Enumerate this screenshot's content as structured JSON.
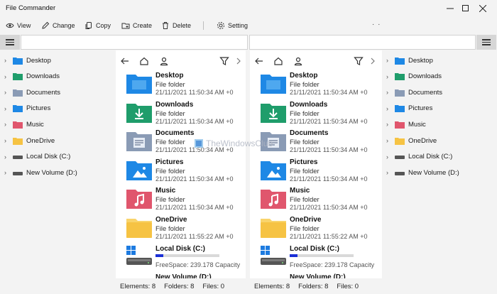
{
  "window": {
    "title": "File Commander"
  },
  "toolbar": {
    "view": "View",
    "change": "Change",
    "copy": "Copy",
    "create": "Create",
    "delete": "Delete",
    "setting": "Setting",
    "more": "· ·"
  },
  "tree": {
    "items": [
      {
        "label": "Desktop",
        "icon": "desktop-folder-icon"
      },
      {
        "label": "Downloads",
        "icon": "downloads-folder-icon"
      },
      {
        "label": "Documents",
        "icon": "documents-folder-icon"
      },
      {
        "label": "Pictures",
        "icon": "pictures-folder-icon"
      },
      {
        "label": "Music",
        "icon": "music-folder-icon"
      },
      {
        "label": "OneDrive",
        "icon": "onedrive-folder-icon"
      },
      {
        "label": "Local Disk (C:)",
        "icon": "drive-icon"
      },
      {
        "label": "New Volume (D:)",
        "icon": "drive-icon"
      }
    ]
  },
  "pane": {
    "entries": [
      {
        "name": "Desktop",
        "type": "File folder",
        "date": "21/11/2021 11:50:34 AM +0"
      },
      {
        "name": "Downloads",
        "type": "File folder",
        "date": "21/11/2021 11:50:34 AM +0"
      },
      {
        "name": "Documents",
        "type": "File folder",
        "date": "21/11/2021 11:50:34 AM +0"
      },
      {
        "name": "Pictures",
        "type": "File folder",
        "date": "21/11/2021 11:50:34 AM +0"
      },
      {
        "name": "Music",
        "type": "File folder",
        "date": "21/11/2021 11:50:34 AM +0"
      },
      {
        "name": "OneDrive",
        "type": "File folder",
        "date": "21/11/2021 11:55:22 AM +0"
      }
    ],
    "drive": {
      "name": "Local Disk (C:)",
      "free": "FreeSpace: 239.178 Capacity",
      "used_fraction": 0.12
    },
    "next_partial": "New Volume (D:)",
    "status": {
      "elements": "Elements: 8",
      "folders": "Folders: 8",
      "files": "Files: 0"
    }
  },
  "watermark": {
    "text": "TheWindowsClub"
  },
  "colors": {
    "accent": "#1a2fd6",
    "folder_blue": "#1e88e5",
    "folder_green": "#1f9d6b",
    "folder_gray": "#8a9bb5",
    "folder_pink": "#e0566d",
    "folder_yellow": "#f6c343"
  }
}
